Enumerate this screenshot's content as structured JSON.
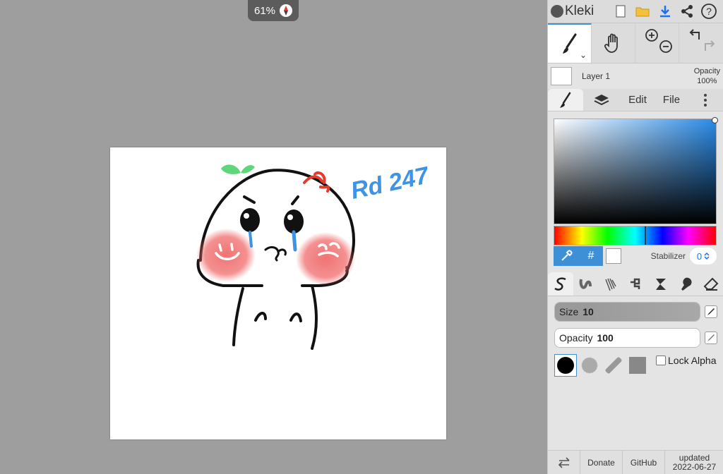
{
  "workspace": {
    "zoom": "61%"
  },
  "app": {
    "name": "Kleki"
  },
  "layer": {
    "name": "Layer 1",
    "opacity_label": "Opacity",
    "opacity_value": "100%"
  },
  "tabs": {
    "edit": "Edit",
    "file": "File"
  },
  "color": {
    "hex_symbol": "#",
    "primary": "#000000",
    "secondary": "#ffffff"
  },
  "stabilizer": {
    "label": "Stabilizer",
    "value": "0"
  },
  "brush": {
    "size_label": "Size",
    "size_value": "10",
    "size_fraction": 0.2,
    "opacity_label": "Opacity",
    "opacity_value": "100",
    "opacity_fraction": 1.0
  },
  "lock_alpha": "Lock Alpha",
  "footer": {
    "donate": "Donate",
    "github": "GitHub",
    "updated_label": "updated",
    "updated_date": "2022-06-27"
  },
  "drawing": {
    "signature": "Rd 247"
  },
  "colors": {
    "accent": "#3d8fd6",
    "blush": "#f06c6c",
    "ink": "#111111",
    "leaf": "#5fd67a",
    "angry": "#e33b2e",
    "tear": "#3d93e6"
  }
}
